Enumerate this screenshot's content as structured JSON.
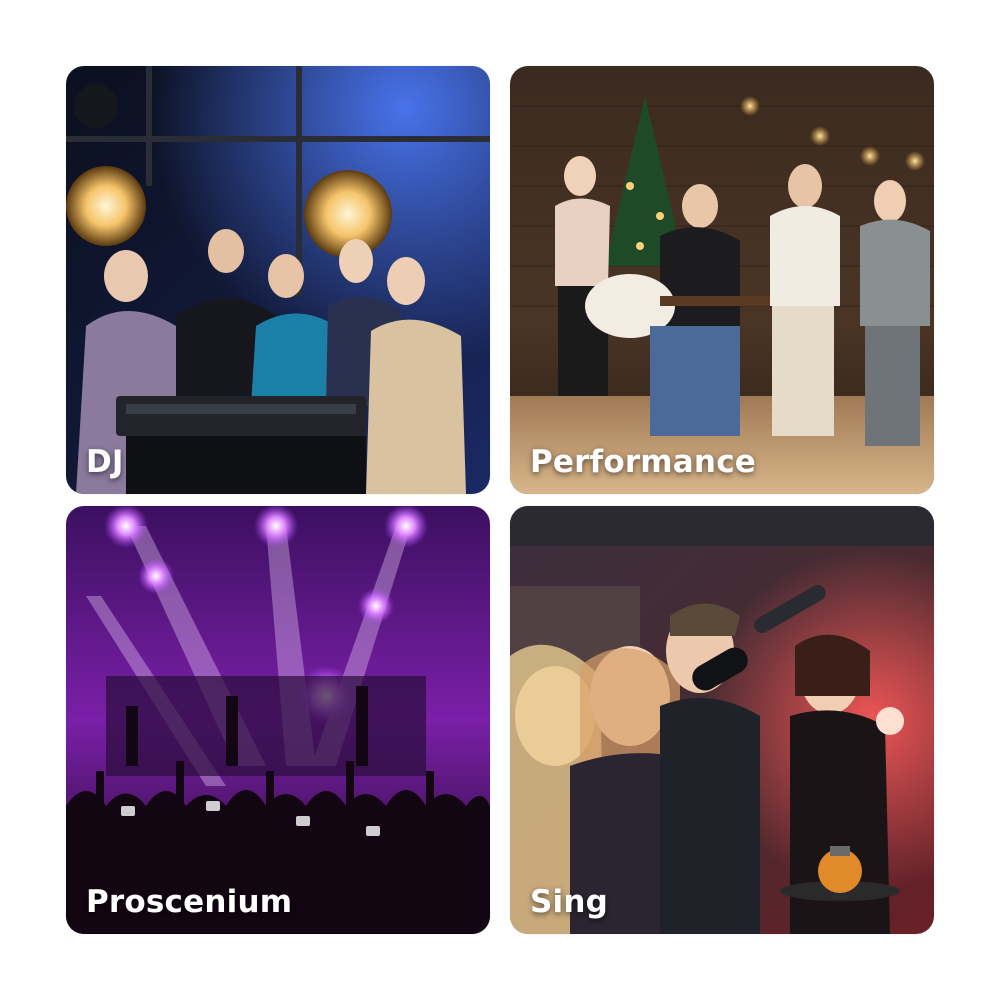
{
  "tiles": [
    {
      "label": "DJ"
    },
    {
      "label": "Performance"
    },
    {
      "label": "Proscenium"
    },
    {
      "label": "Sing"
    }
  ]
}
